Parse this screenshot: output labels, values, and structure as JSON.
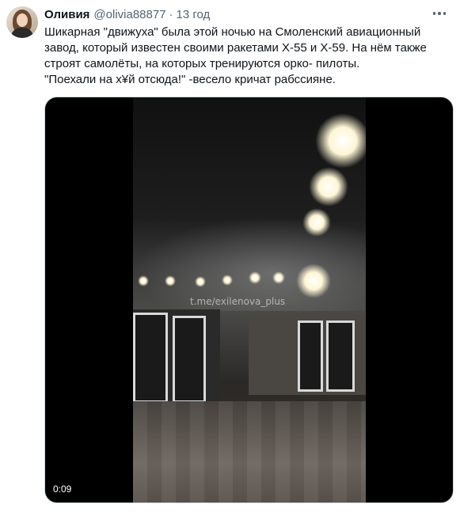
{
  "tweet": {
    "author_name": "Оливия",
    "author_handle": "@olivia88877",
    "separator": "·",
    "timestamp": "13 год",
    "text_lines": [
      "Шикарная \"движуха\" была этой ночью на Смоленский авиационный",
      "завод, который известен своими ракетами Х-55 и Х-59. На нём также",
      "строят самолёты, на которых тренируются орко- пилоты.",
      "\"Поехали на х¥й отсюда!\" -весело кричат рабссияне."
    ],
    "more_icon": "more-horizontal-icon"
  },
  "video": {
    "watermark": "t.me/exilenova_plus",
    "duration": "0:09"
  }
}
